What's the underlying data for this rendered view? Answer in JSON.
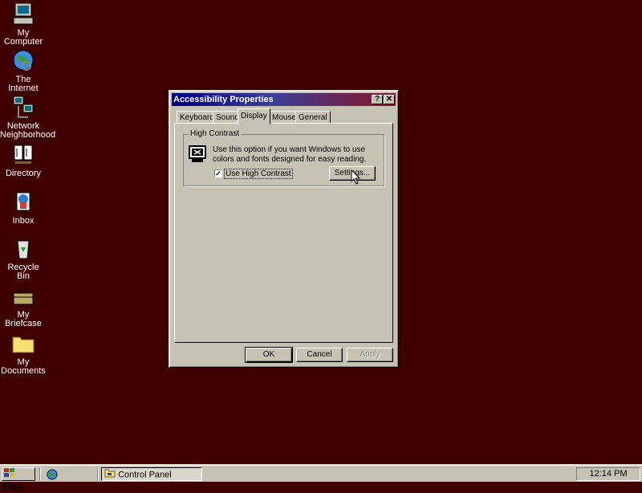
{
  "desktop": {
    "icons": [
      {
        "label": "My Computer",
        "icon": "computer-icon"
      },
      {
        "label": "The Internet",
        "icon": "internet-globe-icon"
      },
      {
        "label": "Network Neighborhood",
        "icon": "network-icon"
      },
      {
        "label": "Directory",
        "icon": "directory-book-icon"
      },
      {
        "label": "Inbox",
        "icon": "inbox-icon"
      },
      {
        "label": "Recycle Bin",
        "icon": "recycle-bin-icon"
      },
      {
        "label": "My Briefcase",
        "icon": "briefcase-icon"
      },
      {
        "label": "My Documents",
        "icon": "folder-icon"
      }
    ],
    "background_color": "#3f0000"
  },
  "dialog": {
    "title": "Accessibility Properties",
    "help_button": "?",
    "close_button": "✕",
    "tabs": [
      {
        "label": "Keyboard",
        "active": false
      },
      {
        "label": "Sound",
        "active": false
      },
      {
        "label": "Display",
        "active": true
      },
      {
        "label": "Mouse",
        "active": false
      },
      {
        "label": "General",
        "active": false
      }
    ],
    "group": {
      "title": "High Contrast",
      "description": "Use this option if you want Windows to use colors and fonts designed for easy reading.",
      "checkbox_label": "Use High Contrast",
      "checkbox_checked": true,
      "settings_button": "Settings..."
    },
    "buttons": {
      "ok": "OK",
      "cancel": "Cancel",
      "apply": "Apply"
    }
  },
  "taskbar": {
    "start_label": "Start",
    "tasks": [
      {
        "label": "Control Panel",
        "active": true
      }
    ],
    "clock": "12:14 PM"
  }
}
